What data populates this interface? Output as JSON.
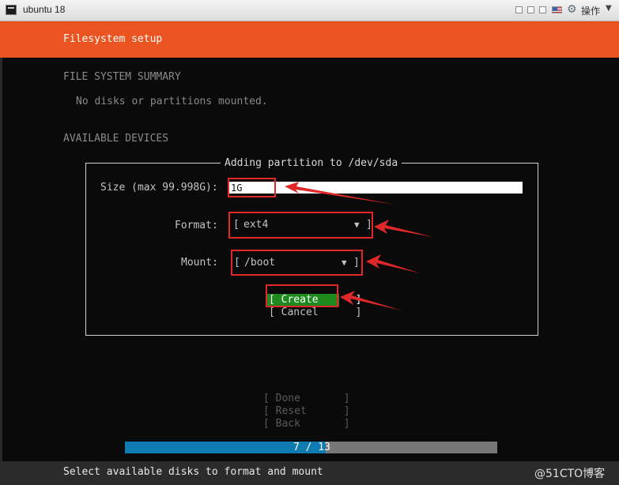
{
  "window": {
    "title": "ubuntu 18",
    "ops_label": "操作",
    "icons": [
      "terminal-icon",
      "window-buttons",
      "flag-icon",
      "gear-icon",
      "chevron-down-icon"
    ]
  },
  "header": {
    "title": "Filesystem setup",
    "bg_color": "#e95420"
  },
  "summary": {
    "heading": "FILE SYSTEM SUMMARY",
    "message": "No disks or partitions mounted."
  },
  "devices": {
    "heading": "AVAILABLE DEVICES"
  },
  "dialog": {
    "title": "Adding partition to /dev/sda",
    "size_label": "Size (max 99.998G):",
    "size_value": "1G",
    "format_label": "Format:",
    "format_open": "[",
    "format_value": "ext4",
    "format_arrow": "▼",
    "format_close": "]",
    "mount_label": "Mount:",
    "mount_open": "[",
    "mount_value": "/boot",
    "mount_arrow": "▼",
    "mount_close": "]",
    "create_label": "[ Create      ]",
    "cancel_label": "[ Cancel      ]"
  },
  "actions": {
    "done_label": "[ Done       ]",
    "reset_label": "[ Reset      ]",
    "back_label": "[ Back       ]"
  },
  "progress": {
    "text": "7 / 13",
    "current": 7,
    "total": 13,
    "fill_color": "#0e7bb1"
  },
  "footer": {
    "hint": "Select available disks to format and mount"
  },
  "watermark": "@51CTO博客",
  "annotation_color": "#e02828"
}
